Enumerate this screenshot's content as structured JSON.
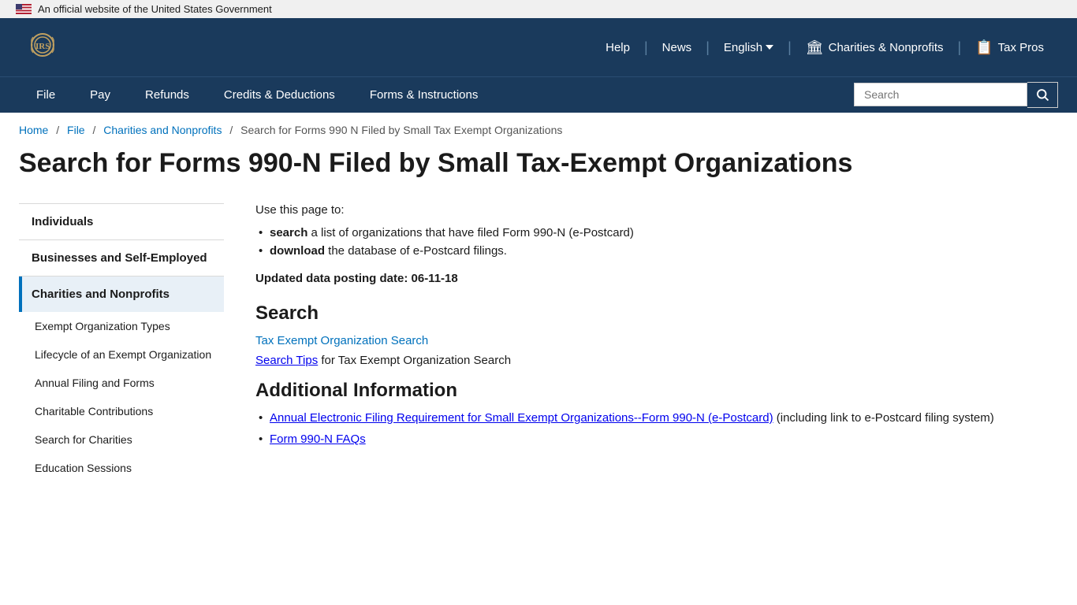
{
  "gov_banner": {
    "text": "An official website of the United States Government"
  },
  "header": {
    "help_label": "Help",
    "news_label": "News",
    "lang_label": "English",
    "charities_label": "Charities & Nonprofits",
    "taxpros_label": "Tax Pros"
  },
  "nav": {
    "items": [
      {
        "label": "File",
        "href": "#"
      },
      {
        "label": "Pay",
        "href": "#"
      },
      {
        "label": "Refunds",
        "href": "#"
      },
      {
        "label": "Credits & Deductions",
        "href": "#"
      },
      {
        "label": "Forms & Instructions",
        "href": "#"
      }
    ],
    "search_placeholder": "Search"
  },
  "breadcrumb": {
    "items": [
      {
        "label": "Home",
        "href": "#"
      },
      {
        "label": "File",
        "href": "#"
      },
      {
        "label": "Charities and Nonprofits",
        "href": "#"
      }
    ],
    "current": "Search for Forms 990 N Filed by Small Tax Exempt Organizations"
  },
  "page": {
    "title": "Search for Forms 990-N Filed by Small Tax-Exempt Organizations"
  },
  "sidebar": {
    "sections": [
      {
        "label": "Individuals",
        "active": false,
        "type": "main"
      },
      {
        "label": "Businesses and Self-Employed",
        "active": false,
        "type": "main"
      },
      {
        "label": "Charities and Nonprofits",
        "active": true,
        "type": "main"
      },
      {
        "label": "Exempt Organization Types",
        "active": false,
        "type": "sub"
      },
      {
        "label": "Lifecycle of an Exempt Organization",
        "active": false,
        "type": "sub"
      },
      {
        "label": "Annual Filing and Forms",
        "active": false,
        "type": "sub"
      },
      {
        "label": "Charitable Contributions",
        "active": false,
        "type": "sub"
      },
      {
        "label": "Search for Charities",
        "active": false,
        "type": "sub"
      },
      {
        "label": "Education Sessions",
        "active": false,
        "type": "sub"
      }
    ]
  },
  "main": {
    "intro": "Use this page to:",
    "bullets": [
      {
        "bold": "search",
        "rest": " a list of organizations that have filed Form 990-N (e-Postcard)"
      },
      {
        "bold": "download",
        "rest": " the database of e-Postcard filings."
      }
    ],
    "updated": "Updated data posting date: 06-11-18",
    "search_heading": "Search",
    "search_link1": "Tax Exempt Organization Search",
    "search_link2_pre": "",
    "search_link2_anchor": "Search Tips",
    "search_link2_post": " for Tax Exempt Organization Search",
    "additional_heading": "Additional Information",
    "additional_items": [
      {
        "link_text": "Annual Electronic Filing Requirement for Small Exempt Organizations--Form 990-N (e-Postcard)",
        "rest": " (including link to e-Postcard filing system)"
      },
      {
        "link_text": "Form 990-N FAQs",
        "rest": ""
      }
    ]
  }
}
